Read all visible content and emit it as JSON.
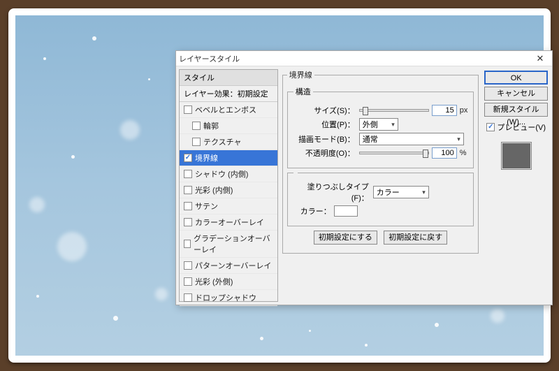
{
  "dialog": {
    "title": "レイヤースタイル",
    "close_glyph": "✕"
  },
  "styles": {
    "header": "スタイル",
    "blend_row": "レイヤー効果：初期設定",
    "items": [
      {
        "label": "ベベルとエンボス",
        "checked": false,
        "indent": false
      },
      {
        "label": "輪郭",
        "checked": false,
        "indent": true
      },
      {
        "label": "テクスチャ",
        "checked": false,
        "indent": true
      },
      {
        "label": "境界線",
        "checked": true,
        "indent": false,
        "selected": true
      },
      {
        "label": "シャドウ (内側)",
        "checked": false,
        "indent": false
      },
      {
        "label": "光彩 (内側)",
        "checked": false,
        "indent": false
      },
      {
        "label": "サテン",
        "checked": false,
        "indent": false
      },
      {
        "label": "カラーオーバーレイ",
        "checked": false,
        "indent": false
      },
      {
        "label": "グラデーションオーバーレイ",
        "checked": false,
        "indent": false
      },
      {
        "label": "パターンオーバーレイ",
        "checked": false,
        "indent": false
      },
      {
        "label": "光彩 (外側)",
        "checked": false,
        "indent": false
      },
      {
        "label": "ドロップシャドウ",
        "checked": false,
        "indent": false
      }
    ]
  },
  "stroke": {
    "group_label": "境界線",
    "structure_label": "構造",
    "size_label": "サイズ(S)：",
    "size_value": "15",
    "size_unit": "px",
    "position_label": "位置(P)：",
    "position_value": "外側",
    "blend_label": "描画モード(B)：",
    "blend_value": "通常",
    "opacity_label": "不透明度(O)：",
    "opacity_value": "100",
    "opacity_unit": "%",
    "fill_group_label": "",
    "fill_type_label": "塗りつぶしタイプ(F)：",
    "fill_type_value": "カラー",
    "color_label": "カラー：",
    "reset_to_default": "初期設定にする",
    "revert_default": "初期設定に戻す"
  },
  "buttons": {
    "ok": "OK",
    "cancel": "キャンセル",
    "new_style": "新規スタイル(W)...",
    "preview_label": "プレビュー(V)"
  }
}
